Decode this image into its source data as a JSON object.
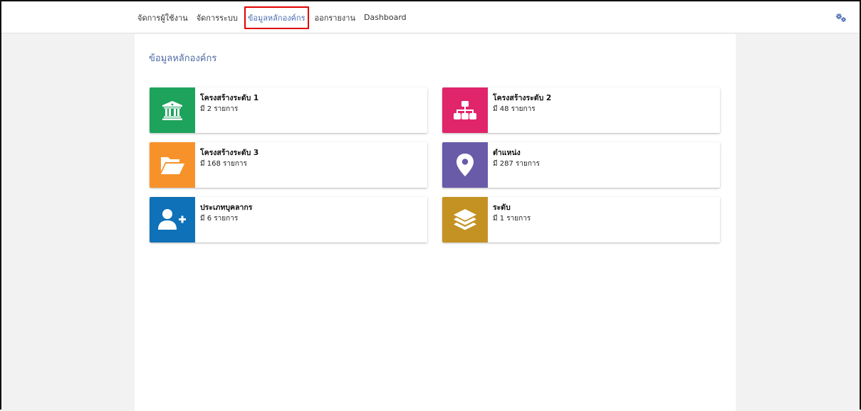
{
  "nav": {
    "items": [
      {
        "label": "จัดการผู้ใช้งาน"
      },
      {
        "label": "จัดการระบบ"
      },
      {
        "label": "ข้อมูลหลักองค์กร",
        "active": true
      },
      {
        "label": "ออกรายงาน"
      },
      {
        "label": "Dashboard"
      }
    ],
    "settings_icon": "gears-icon"
  },
  "page": {
    "title": "ข้อมูลหลักองค์กร"
  },
  "cards": [
    {
      "title": "โครงสร้างระดับ 1",
      "count": "มี 2 รายการ",
      "icon": "building-columns-icon",
      "color": "#1ea35c"
    },
    {
      "title": "โครงสร้างระดับ 2",
      "count": "มี 48 รายการ",
      "icon": "sitemap-icon",
      "color": "#e0256b"
    },
    {
      "title": "โครงสร้างระดับ 3",
      "count": "มี 168 รายการ",
      "icon": "folder-open-icon",
      "color": "#f7922a"
    },
    {
      "title": "ตำแหน่ง",
      "count": "มี 287 รายการ",
      "icon": "map-marker-icon",
      "color": "#6a5ba9"
    },
    {
      "title": "ประเภทบุคลากร",
      "count": "มี 6 รายการ",
      "icon": "user-plus-icon",
      "color": "#0f71b7"
    },
    {
      "title": "ระดับ",
      "count": "มี 1 รายการ",
      "icon": "layers-icon",
      "color": "#c49222"
    }
  ]
}
